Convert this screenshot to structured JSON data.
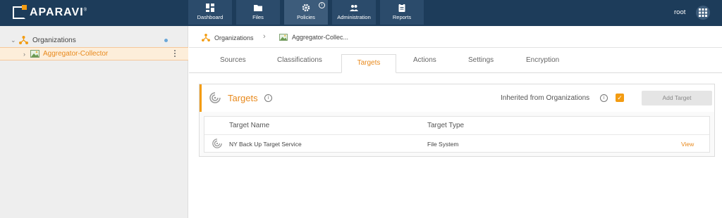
{
  "brand": {
    "name": "APARAVI",
    "mark": "®"
  },
  "nav": [
    {
      "label": "Dashboard",
      "icon": "dashboard-icon"
    },
    {
      "label": "Files",
      "icon": "folder-icon"
    },
    {
      "label": "Policies",
      "icon": "gear-icon",
      "active": true,
      "info": "i"
    },
    {
      "label": "Administration",
      "icon": "users-icon"
    },
    {
      "label": "Reports",
      "icon": "clipboard-icon"
    }
  ],
  "user": {
    "name": "root"
  },
  "sidebar": {
    "items": [
      {
        "label": "Organizations",
        "expanded": true
      },
      {
        "label": "Aggregator-Collector",
        "selected": true
      }
    ]
  },
  "breadcrumb": {
    "items": [
      "Organizations",
      "Aggregator-Collec..."
    ]
  },
  "tabs": [
    {
      "label": "Sources"
    },
    {
      "label": "Classifications"
    },
    {
      "label": "Targets",
      "active": true
    },
    {
      "label": "Actions"
    },
    {
      "label": "Settings"
    },
    {
      "label": "Encryption"
    }
  ],
  "panel": {
    "title": "Targets",
    "info": "i",
    "inherited_label": "Inherited from Organizations",
    "inherited_checked": true,
    "add_button": "Add Target"
  },
  "table": {
    "headers": [
      "Target Name",
      "Target Type"
    ],
    "rows": [
      {
        "name": "NY Back Up Target Service",
        "type": "File System",
        "action": "View"
      }
    ]
  },
  "colors": {
    "topbar": "#1d3c5a",
    "accent": "#f39c12",
    "accent_text": "#e8891c"
  }
}
